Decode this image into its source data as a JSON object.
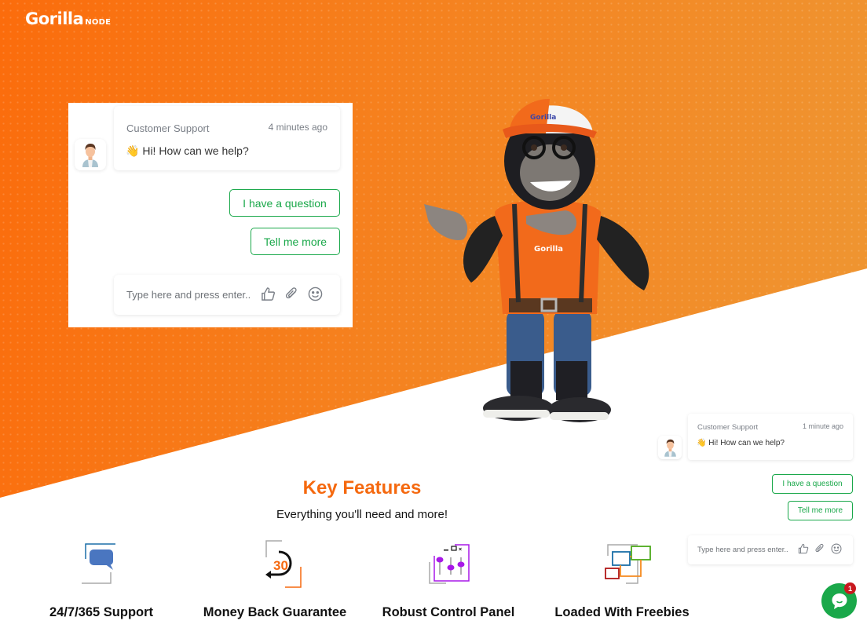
{
  "brand": {
    "name": "Gorilla",
    "suffix": "NODE",
    "accent": "#f5690f",
    "green": "#1aa84a"
  },
  "chat_main": {
    "sender": "Customer Support",
    "time": "4 minutes ago",
    "message": "Hi! How can we help?",
    "wave_icon": "👋",
    "quick_replies": [
      "I have a question",
      "Tell me more"
    ],
    "input_placeholder": "Type here and press enter..",
    "input_icons": [
      "thumbs-up-icon",
      "paperclip-icon",
      "emoji-icon"
    ]
  },
  "chat_widget": {
    "sender": "Customer Support",
    "time": "1 minute ago",
    "message": "Hi! How can we help?",
    "wave_icon": "👋",
    "quick_replies": [
      "I have a question",
      "Tell me more"
    ],
    "input_placeholder": "Type here and press enter..",
    "unread_count": "1"
  },
  "features": {
    "title": "Key Features",
    "subtitle": "Everything you'll need and more!",
    "items": [
      {
        "label": "24/7/365 Support",
        "icon": "chat-bubble-icon"
      },
      {
        "label": "Money Back Guarantee",
        "icon": "30-day-return-icon",
        "badge": "30"
      },
      {
        "label": "Robust Control Panel",
        "icon": "control-panel-sliders-icon"
      },
      {
        "label": "Loaded With Freebies",
        "icon": "connected-windows-icon"
      }
    ]
  },
  "mascot": {
    "shirt_text": "Gorilla",
    "cap_text": "Gorilla NODE"
  }
}
